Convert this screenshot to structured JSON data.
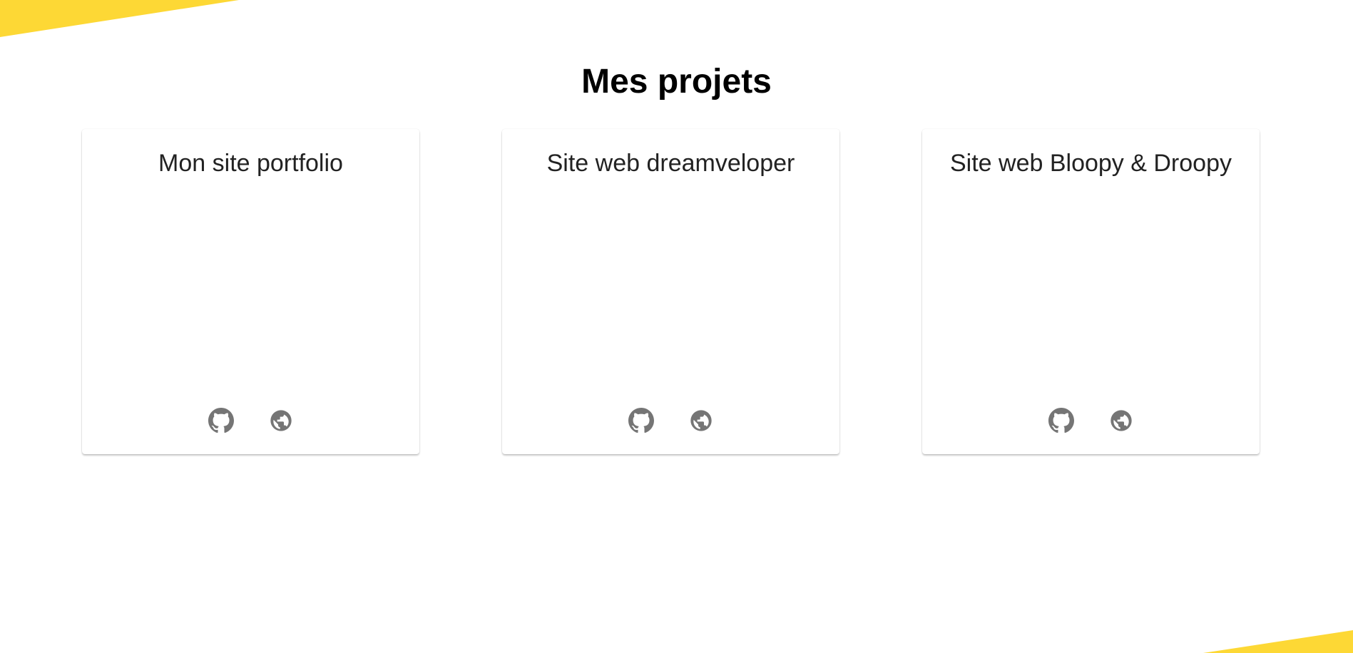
{
  "page": {
    "title": "Mes projets",
    "accent_color": "#FDD835",
    "icon_color": "#757575"
  },
  "projects": [
    {
      "title": "Mon site portfolio",
      "actions": [
        {
          "icon": "github-icon"
        },
        {
          "icon": "globe-icon"
        }
      ]
    },
    {
      "title": "Site web dreamveloper",
      "actions": [
        {
          "icon": "github-icon"
        },
        {
          "icon": "globe-icon"
        }
      ]
    },
    {
      "title": "Site web Bloopy & Droopy",
      "actions": [
        {
          "icon": "github-icon"
        },
        {
          "icon": "globe-icon"
        }
      ]
    }
  ]
}
